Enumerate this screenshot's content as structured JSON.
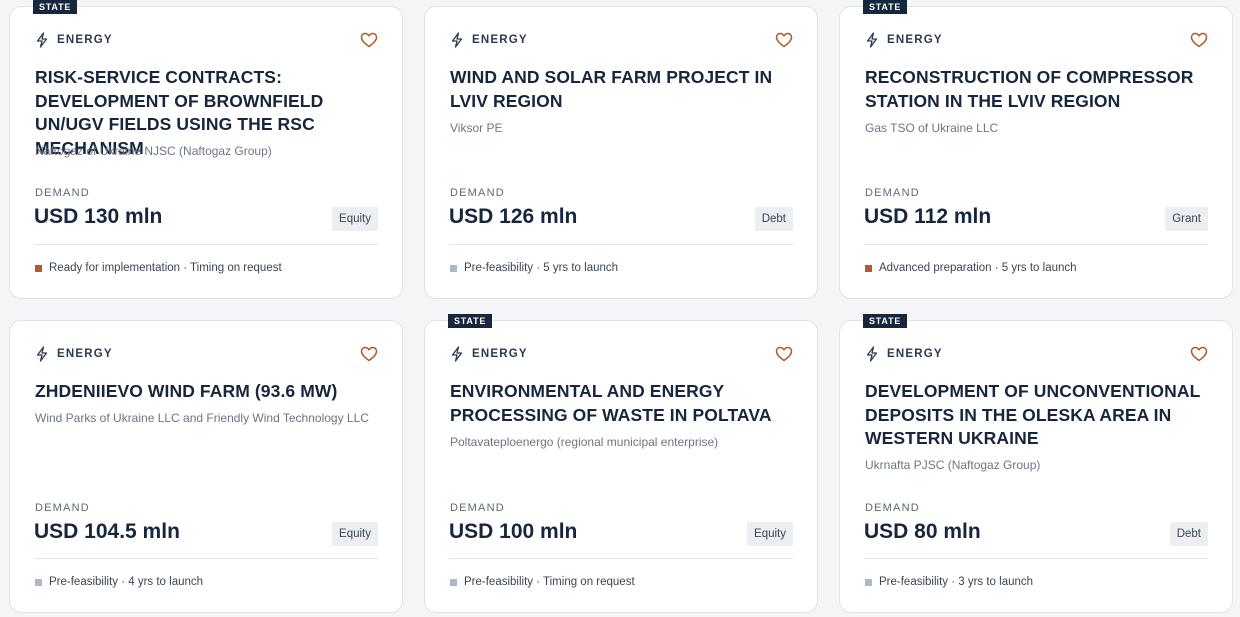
{
  "colors": {
    "ready": "#b5592a",
    "prefeasibility": "#aab8cc",
    "heart": "#b5592a",
    "navy": "#16263d"
  },
  "cards": [
    {
      "state_badge": "STATE",
      "sector": "ENERGY",
      "title": "RISK-SERVICE CONTRACTS: DEVELOPMENT OF BROWNFIELD UN/UGV FIELDS USING THE RSC MECHANISM",
      "org": "Naftogaz of Ukraine NJSC (Naftogaz Group)",
      "demand_label": "DEMAND",
      "amount": "USD 130 mln",
      "type": "Equity",
      "status": "Ready for implementation · Timing on request",
      "status_color": "#b5592a"
    },
    {
      "state_badge": "",
      "sector": "ENERGY",
      "title": "WIND AND SOLAR FARM PROJECT IN LVIV REGION",
      "org": "Viksor PE",
      "demand_label": "DEMAND",
      "amount": "USD 126 mln",
      "type": "Debt",
      "status": "Pre-feasibility · 5 yrs to launch",
      "status_color": "#aab8cc"
    },
    {
      "state_badge": "STATE",
      "sector": "ENERGY",
      "title": "RECONSTRUCTION OF COMPRESSOR STATION IN THE LVIV REGION",
      "org": "Gas TSO of Ukraine LLC",
      "demand_label": "DEMAND",
      "amount": "USD 112 mln",
      "type": "Grant",
      "status": "Advanced preparation · 5 yrs to launch",
      "status_color": "#b5592a"
    },
    {
      "state_badge": "",
      "sector": "ENERGY",
      "title": "ZHDENIIEVO WIND FARM (93.6 MW)",
      "org": "Wind Parks of Ukraine LLC and Friendly Wind Technology LLC",
      "demand_label": "DEMAND",
      "amount": "USD 104.5 mln",
      "type": "Equity",
      "status": "Pre-feasibility · 4 yrs to launch",
      "status_color": "#aab8cc"
    },
    {
      "state_badge": "STATE",
      "sector": "ENERGY",
      "title": "ENVIRONMENTAL AND ENERGY PROCESSING OF WASTE IN POLTAVA",
      "org": "Poltavateploenergo (regional municipal enterprise)",
      "demand_label": "DEMAND",
      "amount": "USD 100 mln",
      "type": "Equity",
      "status": "Pre-feasibility · Timing on request",
      "status_color": "#aab8cc"
    },
    {
      "state_badge": "STATE",
      "sector": "ENERGY",
      "title": "DEVELOPMENT OF UNCONVENTIONAL DEPOSITS IN THE OLESKA AREA IN WESTERN UKRAINE",
      "org": "Ukrnafta PJSC (Naftogaz Group)",
      "demand_label": "DEMAND",
      "amount": "USD 80 mln",
      "type": "Debt",
      "status": "Pre-feasibility · 3 yrs to launch",
      "status_color": "#aab8cc"
    }
  ]
}
